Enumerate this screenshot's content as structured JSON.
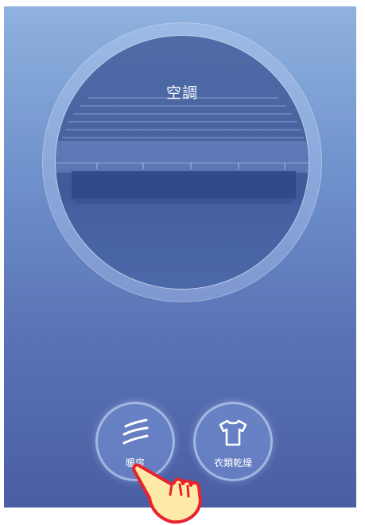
{
  "main_mode": {
    "icon": "fan-icon",
    "label": "空調"
  },
  "buttons": [
    {
      "icon": "heat-waves-icon",
      "label": "暖房"
    },
    {
      "icon": "shirt-icon",
      "label": "衣類乾燥"
    }
  ],
  "cursor": {
    "icon": "hand-pointer-icon"
  },
  "colors": {
    "background_top": "#8fb2df",
    "background_bottom": "#4a5ea3",
    "dial_fill": "#4862a0",
    "text": "#ffffff",
    "cursor_fill": "#fde9a8",
    "cursor_outline": "#e8232c"
  }
}
